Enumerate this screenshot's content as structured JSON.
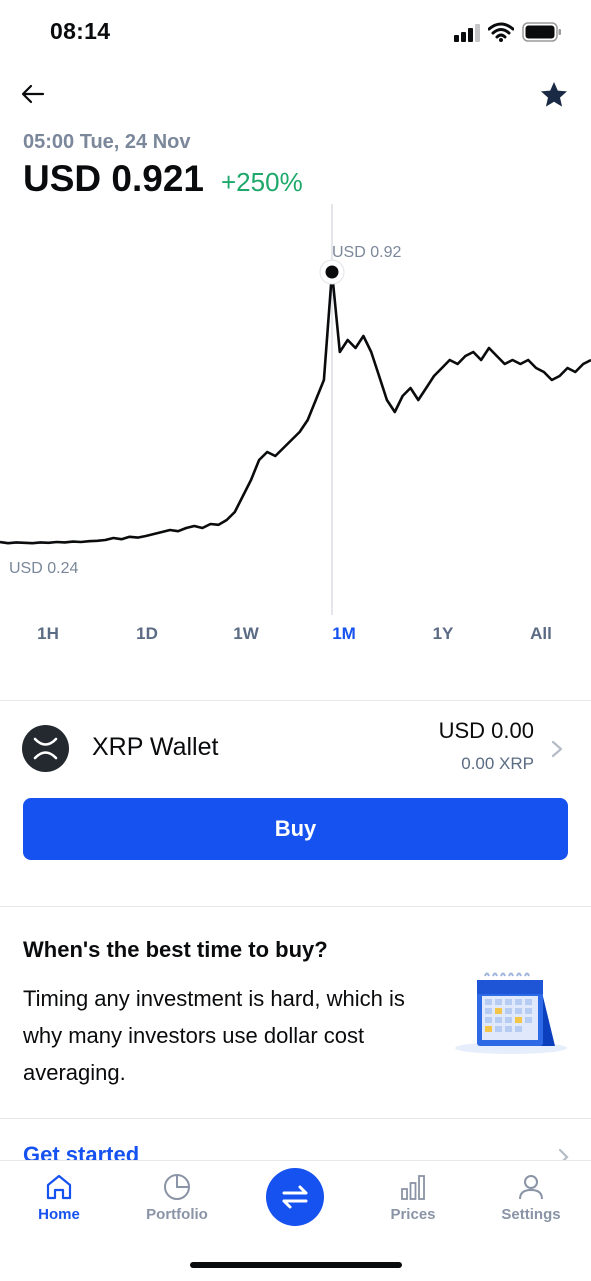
{
  "status_bar": {
    "time": "08:14"
  },
  "header": {
    "back_icon": "arrow-left-icon",
    "favorite_icon": "star-icon"
  },
  "price": {
    "timestamp": "05:00 Tue, 24 Nov",
    "value": "USD 0.921",
    "change": "+250%",
    "change_color": "#1ea86a"
  },
  "chart_data": {
    "type": "line",
    "max_label": "USD 0.92",
    "min_label": "USD 0.24",
    "y_min": 0.24,
    "y_max": 0.92,
    "series": [
      {
        "values": [
          0.245,
          0.242,
          0.244,
          0.243,
          0.242,
          0.244,
          0.243,
          0.245,
          0.244,
          0.246,
          0.245,
          0.247,
          0.248,
          0.25,
          0.255,
          0.252,
          0.258,
          0.256,
          0.26,
          0.265,
          0.27,
          0.275,
          0.272,
          0.28,
          0.285,
          0.28,
          0.29,
          0.288,
          0.3,
          0.32,
          0.36,
          0.4,
          0.45,
          0.47,
          0.46,
          0.48,
          0.5,
          0.52,
          0.55,
          0.6,
          0.65,
          0.92,
          0.72,
          0.75,
          0.73,
          0.76,
          0.72,
          0.66,
          0.6,
          0.57,
          0.61,
          0.63,
          0.6,
          0.63,
          0.66,
          0.68,
          0.7,
          0.69,
          0.71,
          0.72,
          0.7,
          0.73,
          0.71,
          0.69,
          0.7,
          0.69,
          0.7,
          0.68,
          0.67,
          0.65,
          0.66,
          0.68,
          0.67,
          0.69,
          0.7
        ]
      }
    ],
    "highlight_index": 41
  },
  "ranges": [
    "1H",
    "1D",
    "1W",
    "1M",
    "1Y",
    "All"
  ],
  "active_range": "1M",
  "wallet": {
    "name": "XRP Wallet",
    "usd": "USD 0.00",
    "xrp": "0.00 XRP",
    "icon": "xrp-logo-icon"
  },
  "buy_label": "Buy",
  "tip": {
    "title": "When's the best time to buy?",
    "body": "Timing any investment is hard, which is why many investors use dollar cost averaging.",
    "illustration": "calendar-icon"
  },
  "get_started": "Get started",
  "tabs": [
    {
      "label": "Home",
      "icon": "home-icon"
    },
    {
      "label": "Portfolio",
      "icon": "pie-chart-icon"
    },
    {
      "label": "Prices",
      "icon": "bar-chart-icon"
    },
    {
      "label": "Settings",
      "icon": "user-icon"
    }
  ],
  "trade_icon": "swap-arrows-icon",
  "colors": {
    "accent": "#1652f0",
    "positive": "#1ea86a"
  }
}
